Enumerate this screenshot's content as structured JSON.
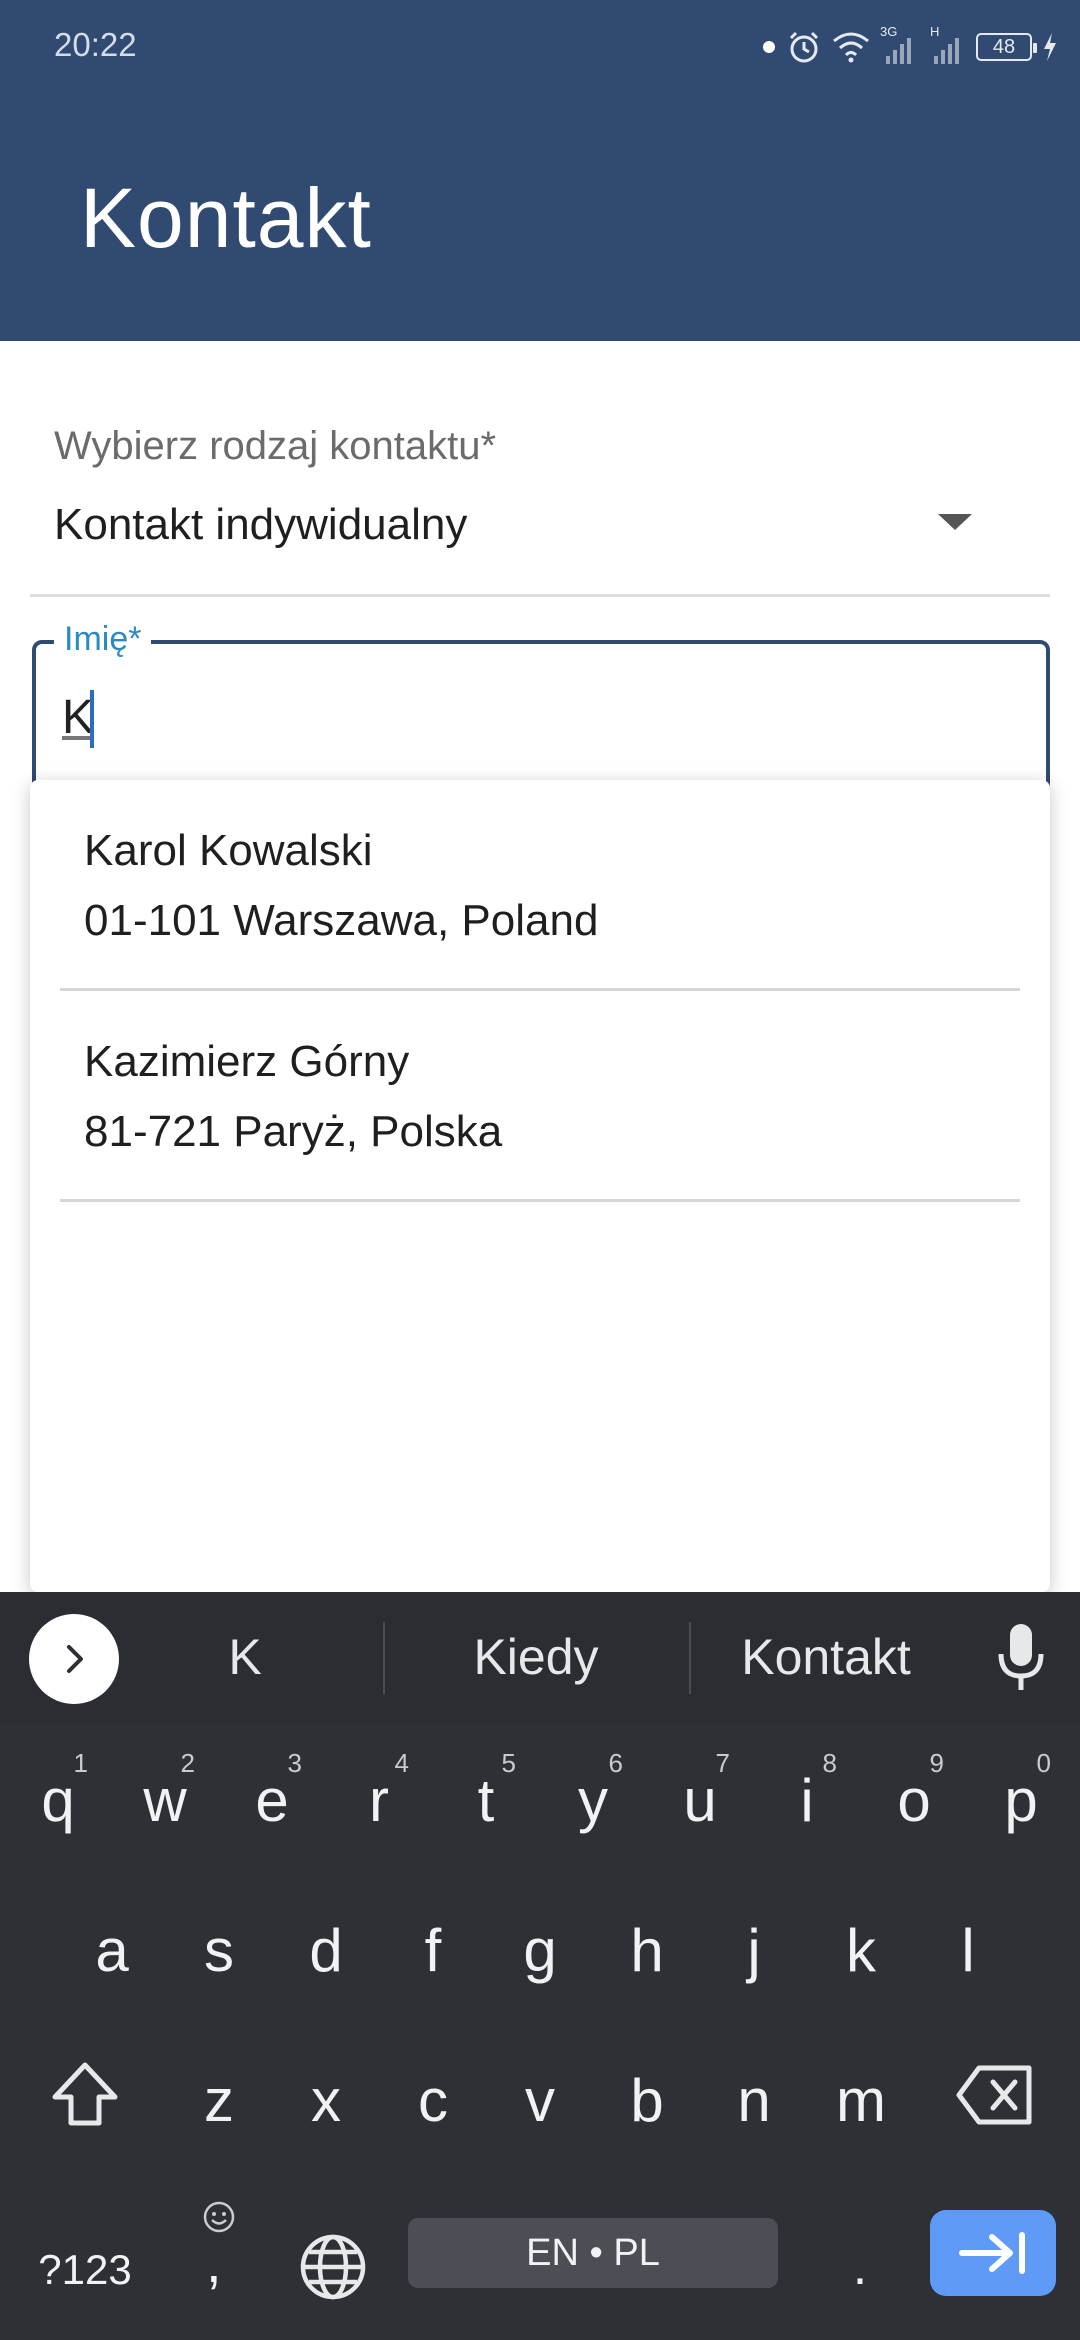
{
  "status_bar": {
    "time": "20:22",
    "network_3g": "3G",
    "network_h": "H",
    "battery": "48"
  },
  "header": {
    "title": "Kontakt"
  },
  "form": {
    "contact_type": {
      "label": "Wybierz rodzaj kontaktu*",
      "value": "Kontakt indywidualny"
    },
    "first_name": {
      "label": "Imię*",
      "value": "K"
    }
  },
  "suggestions": [
    {
      "name": "Karol Kowalski",
      "address": "01-101 Warszawa, Poland"
    },
    {
      "name": "Kazimierz Górny",
      "address": "81-721 Paryż, Polska"
    }
  ],
  "keyboard": {
    "suggestions": [
      "K",
      "Kiedy",
      "Kontakt"
    ],
    "row1": [
      {
        "key": "q",
        "num": "1"
      },
      {
        "key": "w",
        "num": "2"
      },
      {
        "key": "e",
        "num": "3"
      },
      {
        "key": "r",
        "num": "4"
      },
      {
        "key": "t",
        "num": "5"
      },
      {
        "key": "y",
        "num": "6"
      },
      {
        "key": "u",
        "num": "7"
      },
      {
        "key": "i",
        "num": "8"
      },
      {
        "key": "o",
        "num": "9"
      },
      {
        "key": "p",
        "num": "0"
      }
    ],
    "row2": [
      "a",
      "s",
      "d",
      "f",
      "g",
      "h",
      "j",
      "k",
      "l"
    ],
    "row3": [
      "z",
      "x",
      "c",
      "v",
      "b",
      "n",
      "m"
    ],
    "symbols_label": "?123",
    "emoji_comma": ",",
    "space_label": "EN • PL",
    "period": ".",
    "icons": {
      "expand": "chevron-right-icon",
      "mic": "mic-icon",
      "shift": "shift-icon",
      "backspace": "backspace-icon",
      "globe": "globe-icon",
      "enter": "next-arrow-icon"
    }
  },
  "colors": {
    "app_bar": "#304a72",
    "label_focus": "#2a8bc0",
    "keyboard_bg": "#2d3035",
    "enter_key": "#5f9bf6"
  }
}
